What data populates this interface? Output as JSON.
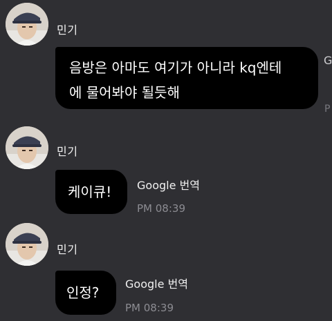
{
  "messages": [
    {
      "sender": "민기",
      "lines": [
        "음방은 아마도 여기가 아니라 kq엔테",
        "에 물어봐야 될듯해"
      ],
      "translate_label": "G",
      "time": "P"
    },
    {
      "sender": "민기",
      "lines": [
        "케이큐!"
      ],
      "translate_label": "Google 번역",
      "time": "PM 08:39"
    },
    {
      "sender": "민기",
      "lines": [
        "인정?"
      ],
      "translate_label": "Google 번역",
      "time": "PM 08:39"
    }
  ]
}
